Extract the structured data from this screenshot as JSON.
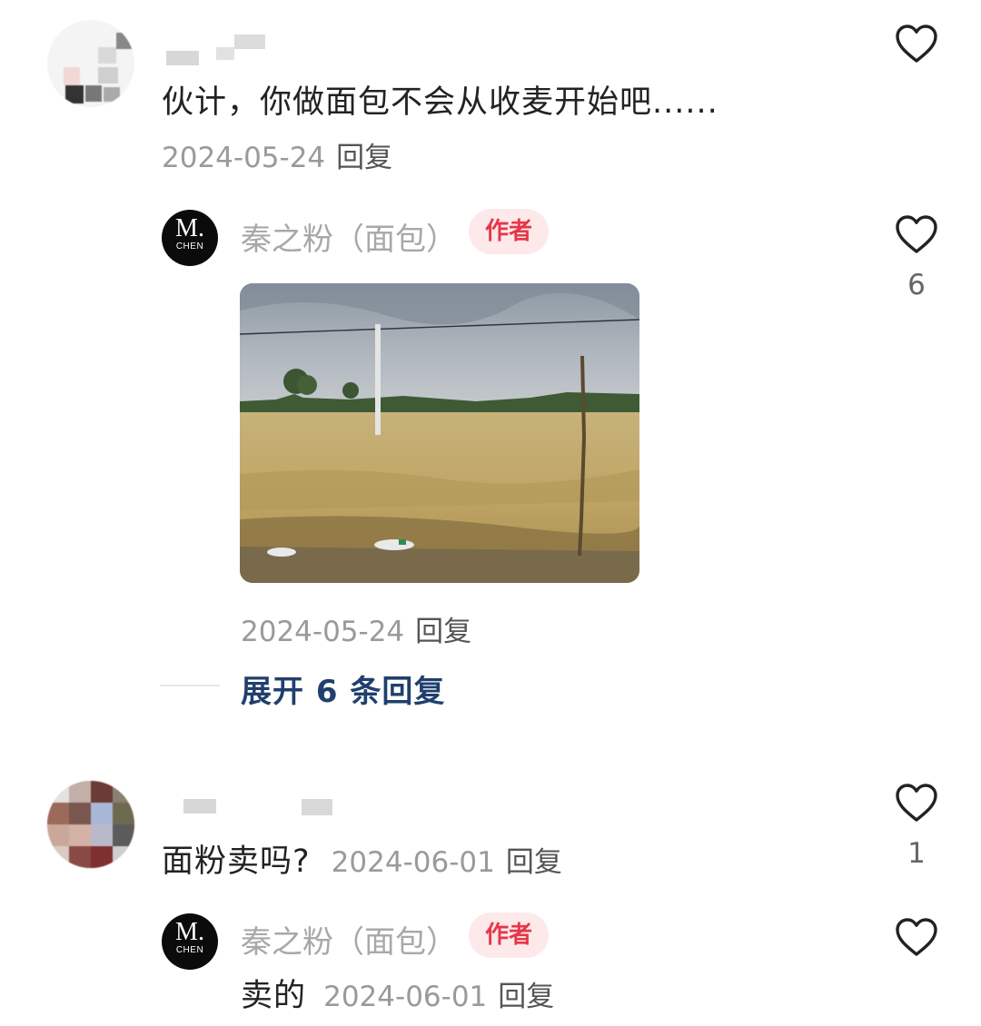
{
  "comments": [
    {
      "text": "伙计，你做面包不会从收麦开始吧......",
      "date": "2024-05-24",
      "reply_label": "回复",
      "like_count": "",
      "reply": {
        "author_name": "秦之粉（面包）",
        "author_badge": "作者",
        "avatar_text_big": "M.",
        "avatar_text_small": "CHEN",
        "image_alt": "wheat field photo",
        "date": "2024-05-24",
        "reply_label": "回复",
        "like_count": "6"
      },
      "expand_label": "展开 6 条回复"
    },
    {
      "text": "面粉卖吗?",
      "date": "2024-06-01",
      "reply_label": "回复",
      "like_count": "1",
      "reply": {
        "author_name": "秦之粉（面包）",
        "author_badge": "作者",
        "avatar_text_big": "M.",
        "avatar_text_small": "CHEN",
        "text": "卖的",
        "date": "2024-06-01",
        "reply_label": "回复",
        "like_count": ""
      }
    }
  ],
  "icons": {
    "like": "heart-outline-icon"
  },
  "colors": {
    "badge_bg": "#fde8ea",
    "badge_text": "#e6364a",
    "expand_link": "#203f6d",
    "meta_gray": "#9a9a9a"
  }
}
